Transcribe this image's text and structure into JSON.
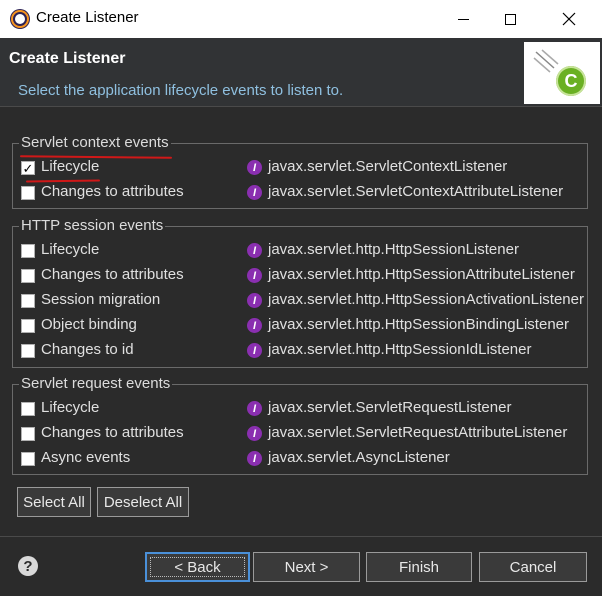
{
  "window": {
    "title": "Create Listener"
  },
  "banner": {
    "title": "Create Listener",
    "description": "Select the application lifecycle events to listen to.",
    "image_icon": "listener-wizard-banner-icon",
    "image_letter": "C"
  },
  "groups": [
    {
      "title": "Servlet context events",
      "rows": [
        {
          "label": "Lifecycle",
          "checked": true,
          "interface": "javax.servlet.ServletContextListener"
        },
        {
          "label": "Changes to attributes",
          "checked": false,
          "interface": "javax.servlet.ServletContextAttributeListener"
        }
      ]
    },
    {
      "title": "HTTP session events",
      "rows": [
        {
          "label": "Lifecycle",
          "checked": false,
          "interface": "javax.servlet.http.HttpSessionListener"
        },
        {
          "label": "Changes to attributes",
          "checked": false,
          "interface": "javax.servlet.http.HttpSessionAttributeListener"
        },
        {
          "label": "Session migration",
          "checked": false,
          "interface": "javax.servlet.http.HttpSessionActivationListener"
        },
        {
          "label": "Object binding",
          "checked": false,
          "interface": "javax.servlet.http.HttpSessionBindingListener"
        },
        {
          "label": "Changes to id",
          "checked": false,
          "interface": "javax.servlet.http.HttpSessionIdListener"
        }
      ]
    },
    {
      "title": "Servlet request events",
      "rows": [
        {
          "label": "Lifecycle",
          "checked": false,
          "interface": "javax.servlet.ServletRequestListener"
        },
        {
          "label": "Changes to attributes",
          "checked": false,
          "interface": "javax.servlet.ServletRequestAttributeListener"
        },
        {
          "label": "Async events",
          "checked": false,
          "interface": "javax.servlet.AsyncListener"
        }
      ]
    }
  ],
  "interface_icon_letter": "I",
  "selection_buttons": {
    "select_all": "Select All",
    "deselect_all": "Deselect All"
  },
  "footer": {
    "help_glyph": "?",
    "back": "< Back",
    "next": "Next >",
    "finish": "Finish",
    "cancel": "Cancel"
  },
  "colors": {
    "background": "#2b2b2b",
    "banner_description": "#8fc0e0",
    "interface_icon": "#8a2fb0",
    "annotation": "#d01818",
    "default_button_border": "#4a90d9"
  }
}
